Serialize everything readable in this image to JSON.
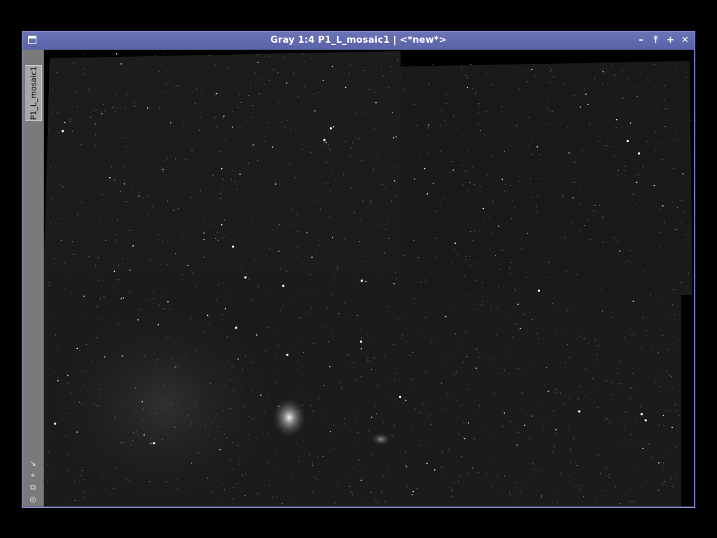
{
  "window": {
    "title": "Gray 1:4 P1_L_mosaic1 | <*new*>",
    "icon": "window-menu-icon",
    "controls": [
      {
        "name": "minimize-button",
        "glyph": "–",
        "icon": "minus-icon"
      },
      {
        "name": "shade-button",
        "glyph": "⤒",
        "icon": "shade-icon"
      },
      {
        "name": "maximize-button",
        "glyph": "+",
        "icon": "plus-icon"
      },
      {
        "name": "close-button",
        "glyph": "✕",
        "icon": "close-icon"
      }
    ]
  },
  "sidebar": {
    "tab_label": "P1_L_mosaic1",
    "tools": [
      {
        "name": "zoom-fit-icon",
        "glyph": "↘"
      },
      {
        "name": "crosshair-icon",
        "glyph": "⌖"
      },
      {
        "name": "clone-icon",
        "glyph": "⧉"
      },
      {
        "name": "target-icon",
        "glyph": "◎"
      }
    ]
  },
  "image": {
    "description_colors": {
      "background": "#000000",
      "sky": "#1b1b1b",
      "nebula": "#d8d8d8"
    }
  }
}
